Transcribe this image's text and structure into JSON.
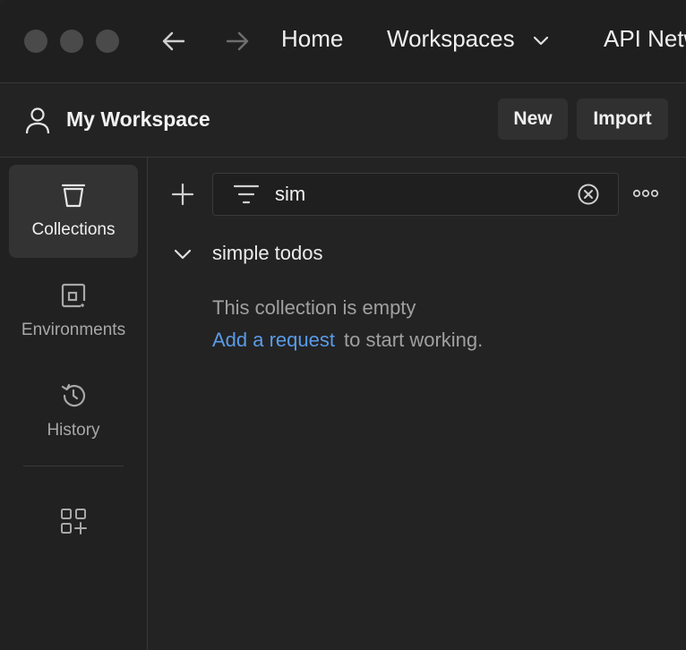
{
  "topbar": {
    "home": "Home",
    "workspaces": "Workspaces",
    "api_network": "API Network"
  },
  "workspace": {
    "title": "My Workspace",
    "new_label": "New",
    "import_label": "Import"
  },
  "sidebar": {
    "items": [
      {
        "label": "Collections",
        "icon": "trash-bucket-icon",
        "active": true
      },
      {
        "label": "Environments",
        "icon": "environment-icon"
      },
      {
        "label": "History",
        "icon": "history-icon"
      }
    ]
  },
  "search": {
    "value": "sim"
  },
  "collections": [
    {
      "name": "simple todos",
      "empty_message": "This collection is empty",
      "add_link": "Add a request",
      "add_hint": "to start working."
    }
  ],
  "colors": {
    "accent_link": "#5a9be8",
    "background": "#212121"
  }
}
